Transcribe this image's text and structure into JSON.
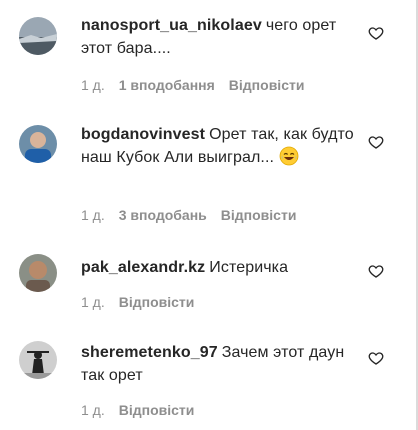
{
  "comments": [
    {
      "username": "nanosport_ua_nikolaev",
      "text": "чего орет этот бара....",
      "time": "1 д.",
      "likes": "1 вподобання",
      "reply": "Відповісти",
      "avatar_icon": "avatar-photo"
    },
    {
      "username": "bogdanovinvest",
      "text": "Орет так, как будто наш Кубок Али выиграл...",
      "emoji": "😂",
      "time": "1 д.",
      "likes": "3 вподобань",
      "reply": "Відповісти",
      "avatar_icon": "avatar-photo"
    },
    {
      "username": "pak_alexandr.kz",
      "text": "Истеричка",
      "time": "1 д.",
      "reply": "Відповісти",
      "avatar_icon": "avatar-photo"
    },
    {
      "username": "sheremetenko_97",
      "text": "Зачем этот даун так орет",
      "time": "1 д.",
      "reply": "Відповісти",
      "avatar_icon": "avatar-photo"
    }
  ],
  "icons": {
    "like": "heart-outline-icon"
  },
  "colors": {
    "text": "#262626",
    "meta": "#8e8e8e"
  }
}
